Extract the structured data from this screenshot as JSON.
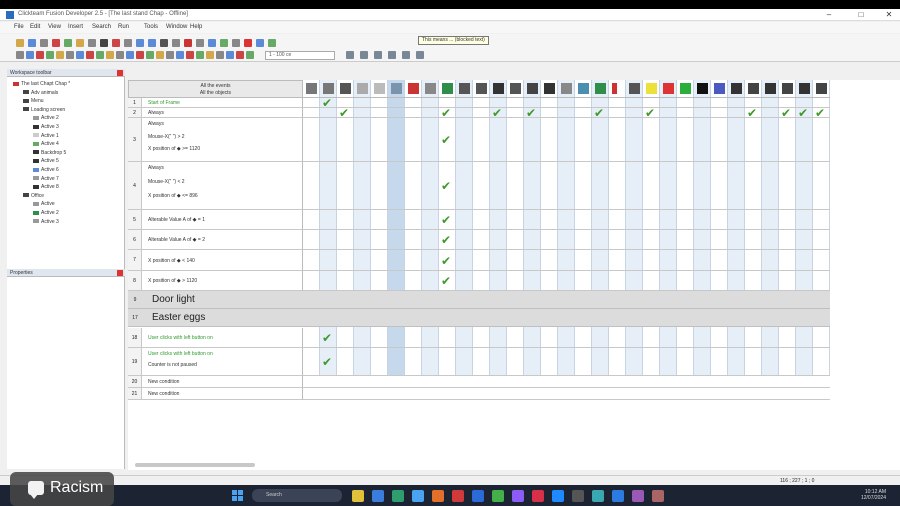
{
  "window": {
    "title": "Clickteam Fusion Developer 2.5 - [The last stand Chap - Offline]"
  },
  "menu": [
    "File",
    "Edit",
    "View",
    "Insert",
    "Search",
    "Run",
    "Tools",
    "Window",
    "Help"
  ],
  "toolbar": {
    "zoom_value": "1 - 100 ce",
    "tooltip": "This means ... (blocked text)"
  },
  "workspace": {
    "header": "Workspace toolbar",
    "tree": [
      {
        "label": "The last Chapt Chap *",
        "level": 0
      },
      {
        "label": "Adv animals",
        "level": 1
      },
      {
        "label": "Menu",
        "level": 1
      },
      {
        "label": "Loading screen",
        "level": 1
      },
      {
        "label": "Active 2",
        "level": 2
      },
      {
        "label": "Active 3",
        "level": 2
      },
      {
        "label": "Active 1",
        "level": 2
      },
      {
        "label": "Active 4",
        "level": 2
      },
      {
        "label": "Backdrop 5",
        "level": 2
      },
      {
        "label": "Active 5",
        "level": 2
      },
      {
        "label": "Active 6",
        "level": 2
      },
      {
        "label": "Active 7",
        "level": 2
      },
      {
        "label": "Active 8",
        "level": 2
      },
      {
        "label": "Office",
        "level": 1
      },
      {
        "label": "Active",
        "level": 2
      },
      {
        "label": "Active 2",
        "level": 2
      },
      {
        "label": "Active 3",
        "level": 2
      }
    ]
  },
  "properties": {
    "header": "Properties"
  },
  "event_editor": {
    "header_line1": "All the events",
    "header_line2": "All the objects",
    "events": [
      {
        "num": "1",
        "lines": [
          {
            "text": "Start of Frame",
            "green": true
          }
        ]
      },
      {
        "num": "2",
        "lines": [
          {
            "text": "Always",
            "green": false
          }
        ]
      },
      {
        "num": "3",
        "lines": [
          {
            "text": "Always"
          },
          {
            "text": "Mouse-X(“  ”) > 2"
          },
          {
            "text": "X position of  ◆  >= 1120"
          }
        ]
      },
      {
        "num": "4",
        "lines": [
          {
            "text": "Always"
          },
          {
            "text": "Mouse-X(“  ”) < 2"
          },
          {
            "text": "X position of  ◆  <= 896"
          }
        ]
      },
      {
        "num": "5",
        "lines": [
          {
            "text": "Alterable Value A of  ◆  = 1"
          }
        ]
      },
      {
        "num": "6",
        "lines": [
          {
            "text": "Alterable Value A of  ◆  = 2"
          }
        ]
      },
      {
        "num": "7",
        "lines": [
          {
            "text": "X position of  ◆  < 140"
          }
        ]
      },
      {
        "num": "8",
        "lines": [
          {
            "text": "X position of  ◆  > 1120"
          }
        ]
      }
    ],
    "groups": [
      {
        "num": "9",
        "label": "Door light"
      },
      {
        "num": "17",
        "label": "Easter eggs"
      }
    ],
    "easter_events": [
      {
        "num": "18",
        "lines": [
          {
            "text": "User clicks with left button on",
            "green": true
          }
        ]
      },
      {
        "num": "19",
        "lines": [
          {
            "text": "User clicks with left button on",
            "green": true
          },
          {
            "text": "Counter is not paused"
          }
        ]
      },
      {
        "num": "20",
        "lines": [
          {
            "text": "New condition"
          }
        ]
      },
      {
        "num": "21",
        "lines": [
          {
            "text": "New condition"
          }
        ]
      }
    ],
    "column_icons": [
      "speaker-icon",
      "sound-icon",
      "storyboard-icon",
      "create-icon",
      "timer-icon",
      "mouse-icon",
      "frame-icon",
      "player-icon",
      "active-object-icon",
      "counter-icon",
      "string-icon",
      "backdrop-icon",
      "text-icon",
      "lives-icon",
      "score-icon",
      "button-icon",
      "object-icon",
      "active-icon",
      "door-icon",
      "red-icon",
      "pc-icon",
      "yellow-icon",
      "red-block-icon",
      "green-block-icon",
      "black-block-icon",
      "lock-icon",
      "obj1-icon",
      "obj2-icon",
      "obj3-icon",
      "obj4-icon",
      "obj5-icon"
    ]
  },
  "status_bar": {
    "left": "",
    "right": "116 ; 227 ; 1 ; 0"
  },
  "taskbar": {
    "search": "Search",
    "clock_time": "10:12 AM",
    "clock_date": "12/07/2024"
  },
  "overlay": {
    "label": "Racism"
  }
}
